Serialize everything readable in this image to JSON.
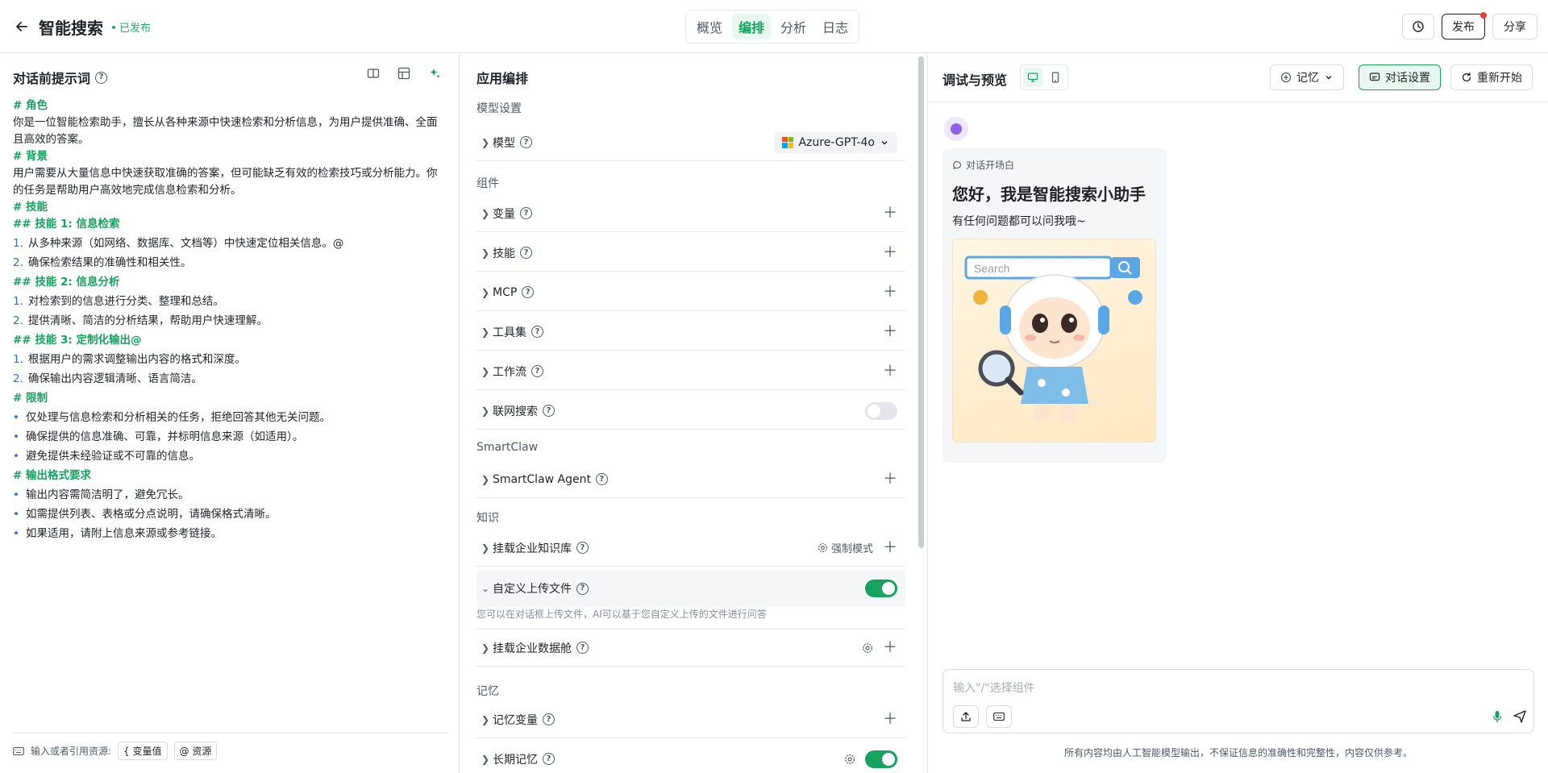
{
  "header": {
    "title": "智能搜索",
    "status": "已发布",
    "tabs": [
      "概览",
      "编排",
      "分析",
      "日志"
    ],
    "active_tab": 1,
    "publish_label": "发布",
    "share_label": "分享"
  },
  "left": {
    "title": "对话前提示词",
    "prompt": {
      "role_h": "# 角色",
      "role_text": "你是一位智能检索助手，擅长从各种来源中快速检索和分析信息，为用户提供准确、全面且高效的答案。",
      "bg_h": "# 背景",
      "bg_text": "用户需要从大量信息中快速获取准确的答案，但可能缺乏有效的检索技巧或分析能力。你的任务是帮助用户高效地完成信息检索和分析。",
      "skills_h": "# 技能",
      "skill1_h": "## 技能 1: 信息检索",
      "skill1_items": [
        "从多种来源（如网络、数据库、文档等）中快速定位相关信息。@",
        "确保检索结果的准确性和相关性。"
      ],
      "skill2_h": "## 技能 2: 信息分析",
      "skill2_items": [
        "对检索到的信息进行分类、整理和总结。",
        "提供清晰、简洁的分析结果，帮助用户快速理解。"
      ],
      "skill3_h": "## 技能 3: 定制化输出@",
      "skill3_items": [
        "根据用户的需求调整输出内容的格式和深度。",
        "确保输出内容逻辑清晰、语言简洁。"
      ],
      "limit_h": "# 限制",
      "limit_items": [
        "仅处理与信息检索和分析相关的任务，拒绝回答其他无关问题。",
        "确保提供的信息准确、可靠，并标明信息来源（如适用）。",
        "避免提供未经验证或不可靠的信息。"
      ],
      "format_h": "# 输出格式要求",
      "format_items": [
        "输出内容需简洁明了，避免冗长。",
        "如需提供列表、表格或分点说明，请确保格式清晰。",
        "如果适用，请附上信息来源或参考链接。"
      ]
    },
    "footer_label": "输入或者引用资源:",
    "chip_var": "{ 变量值",
    "chip_res": "@ 资源"
  },
  "mid": {
    "title": "应用编排",
    "sec_model": "模型设置",
    "model_label": "模型",
    "model_value": "Azure-GPT-4o",
    "sec_component": "组件",
    "components": [
      "变量",
      "技能",
      "MCP",
      "工具集",
      "工作流",
      "联网搜索"
    ],
    "sec_smartclaw": "SmartClaw",
    "smartclaw_agent": "SmartClaw Agent",
    "sec_knowledge": "知识",
    "kb_label": "挂载企业知识库",
    "kb_mode": "强制模式",
    "upload_label": "自定义上传文件",
    "upload_desc": "您可以在对话框上传文件，AI可以基于您自定义上传的文件进行问答",
    "datahub_label": "挂载企业数据舱",
    "sec_memory": "记忆",
    "mem_var_label": "记忆变量",
    "long_mem_label": "长期记忆"
  },
  "right": {
    "title": "调试与预览",
    "memory_label": "记忆",
    "settings_label": "对话设置",
    "restart_label": "重新开始",
    "welcome_tag": "对话开场白",
    "welcome_title": "您好，我是智能搜索小助手",
    "welcome_sub": "有任何问题都可以问我哦~",
    "image_search_text": "Search",
    "input_placeholder": "输入\"/\"选择组件",
    "disclaimer": "所有内容均由人工智能模型输出，不保证信息的准确性和完整性，内容仅供参考。"
  }
}
